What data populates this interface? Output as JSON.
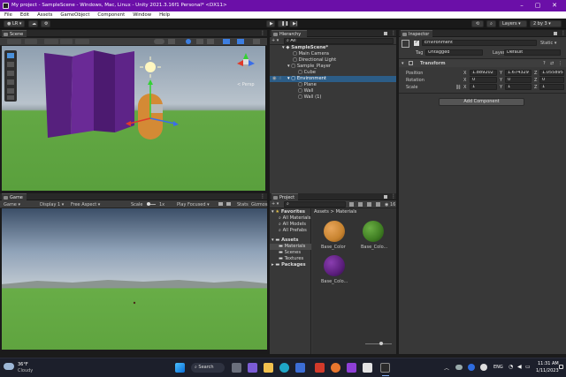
{
  "window": {
    "title": "My project - SampleScene - Windows, Mac, Linux - Unity 2021.3.16f1 Personal* <DX11>"
  },
  "menu": [
    "File",
    "Edit",
    "Assets",
    "GameObject",
    "Component",
    "Window",
    "Help"
  ],
  "toolbar": {
    "account": "LR",
    "layers": "Layers",
    "layout": "2 by 3"
  },
  "scene": {
    "tab": "Scene",
    "persp_label": "< Persp"
  },
  "game": {
    "tab": "Game",
    "mode": "Game",
    "display": "Display 1",
    "aspect": "Free Aspect",
    "scale_label": "Scale",
    "scale_value": "1x",
    "play_focused": "Play Focused",
    "stats": "Stats",
    "gizmos": "Gizmos"
  },
  "hierarchy": {
    "tab": "Hierarchy",
    "search": "All",
    "items": [
      {
        "label": "SampleScene*"
      },
      {
        "label": "Main Camera"
      },
      {
        "label": "Directional Light"
      },
      {
        "label": "Sample_Player"
      },
      {
        "label": "Cube"
      },
      {
        "label": "Environment"
      },
      {
        "label": "Plane"
      },
      {
        "label": "Wall"
      },
      {
        "label": "Wall (1)"
      }
    ]
  },
  "project": {
    "tab": "Project",
    "count": "16",
    "tree": {
      "favorites": "Favorites",
      "fav_items": [
        "All Materials",
        "All Models",
        "All Prefabs"
      ],
      "assets": "Assets",
      "asset_items": [
        "Materials",
        "Scenes",
        "Textures"
      ],
      "packages": "Packages"
    },
    "breadcrumb": {
      "root": "Assets",
      "sep": ">",
      "current": "Materials"
    },
    "files": [
      {
        "label": "Base_Color",
        "color": "#c7832f"
      },
      {
        "label": "Base_Colo...",
        "color": "#3f7d22"
      },
      {
        "label": "Base_Colo...",
        "color": "#5b1e7c"
      }
    ]
  },
  "inspector": {
    "tab": "Inspector",
    "object_name": "Environment",
    "static": "Static",
    "tag_label": "Tag",
    "tag_value": "Untagged",
    "layer_label": "Layer",
    "layer_value": "Default",
    "transform_label": "Transform",
    "position_label": "Position",
    "rotation_label": "Rotation",
    "scale_label": "Scale",
    "position": {
      "x": "1.889202",
      "y": "1.674329",
      "z": "1.055895"
    },
    "rotation": {
      "x": "0",
      "y": "0",
      "z": "0"
    },
    "scale": {
      "x": "1",
      "y": "1",
      "z": "1"
    },
    "add_component": "Add Component"
  },
  "taskbar": {
    "weather_temp": "36°F",
    "weather_desc": "Cloudy",
    "search": "Search",
    "lang": "ENG",
    "time": "11:31 AM",
    "date": "1/11/2023"
  }
}
